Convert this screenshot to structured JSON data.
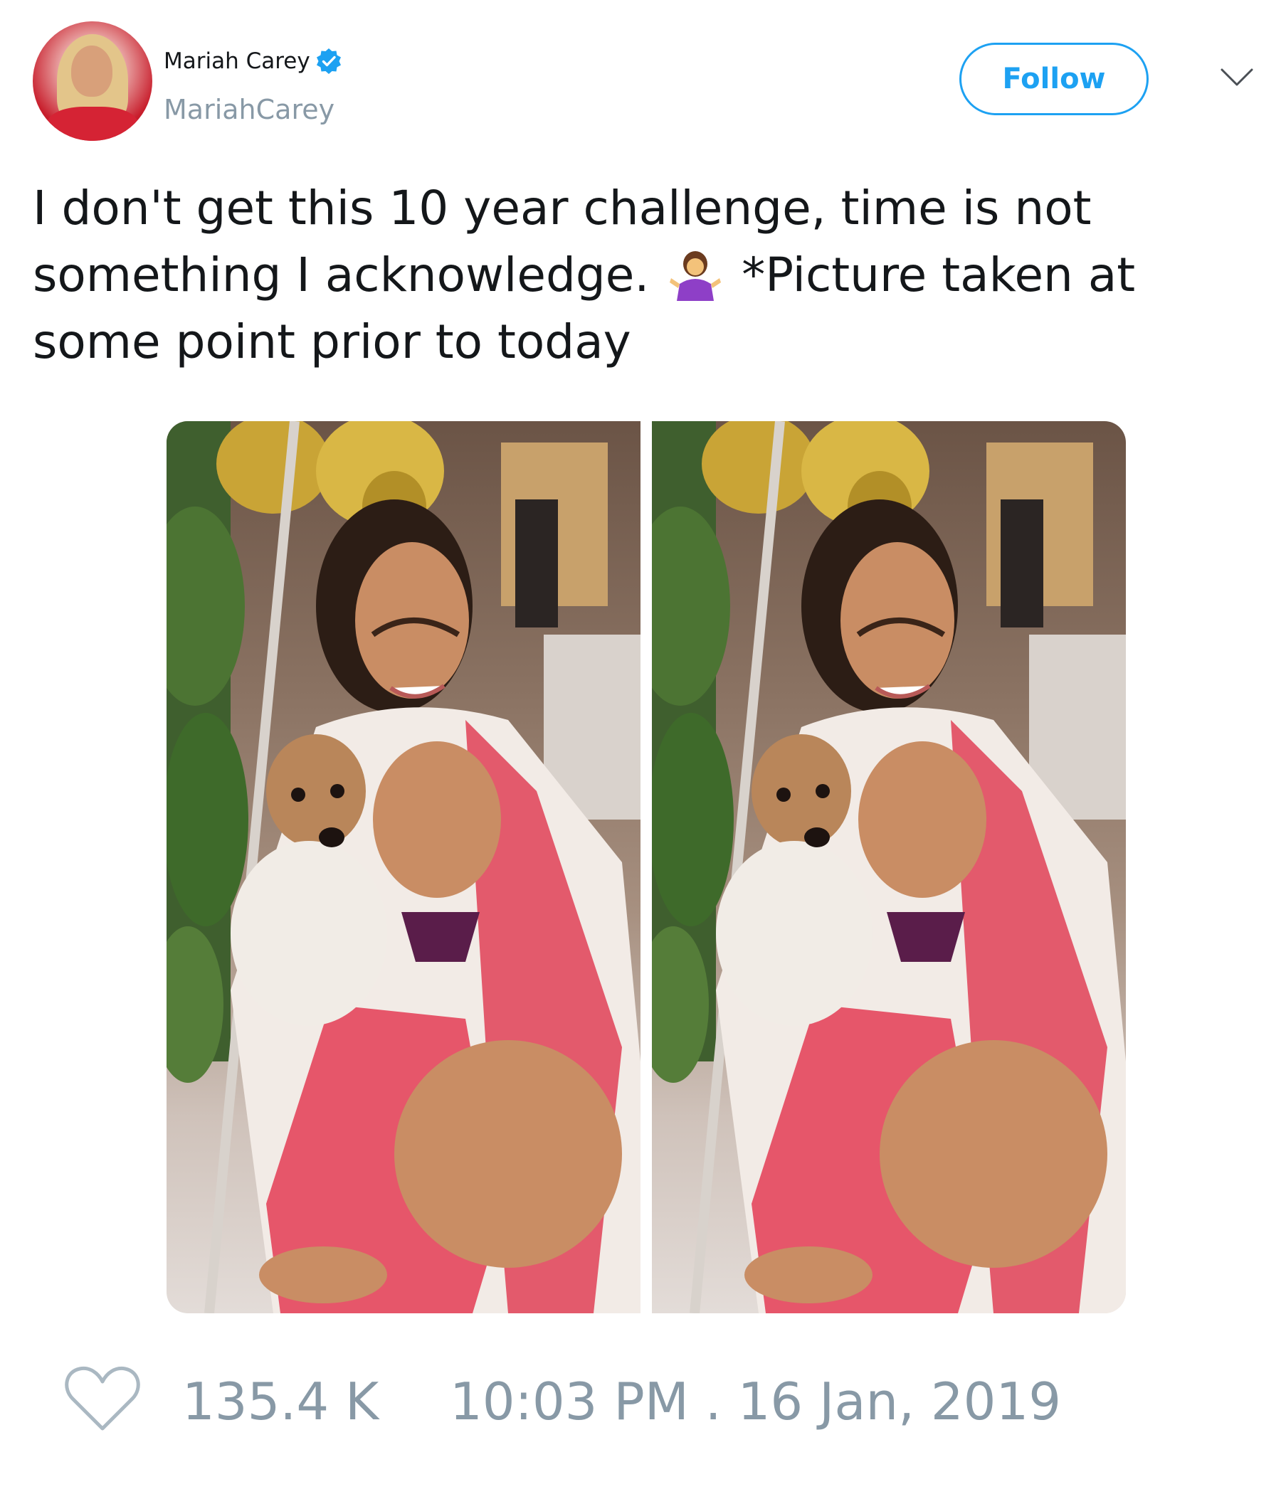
{
  "user": {
    "name": "Mariah Carey",
    "handle": "MariahCarey",
    "verified": true
  },
  "actions": {
    "follow_label": "Follow"
  },
  "tweet": {
    "text_part1": "I don't get this 10 year challenge, time is not something I acknowledge.",
    "emoji": "person-shrugging-emoji",
    "text_part2": "*Picture taken at some point prior to today"
  },
  "media": {
    "count": 2
  },
  "footer": {
    "like_count": "135.4 K",
    "timestamp": "10:03 PM . 16 Jan, 2019"
  },
  "colors": {
    "accent": "#1da1f2",
    "muted": "#8899a6",
    "text": "#14171a",
    "verified": "#1da1f2"
  }
}
